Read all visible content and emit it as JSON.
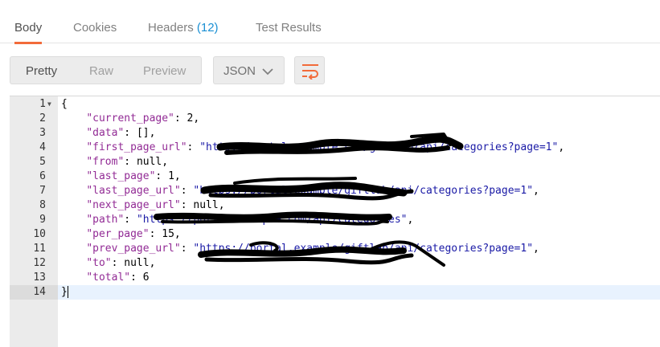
{
  "tabs": [
    {
      "label": "Body",
      "active": true
    },
    {
      "label": "Cookies",
      "active": false
    },
    {
      "label": "Headers",
      "count": "(12)",
      "active": false
    },
    {
      "label": "Test Results",
      "active": false
    }
  ],
  "view_modes": [
    "Pretty",
    "Raw",
    "Preview"
  ],
  "active_view_mode": "Pretty",
  "format": "JSON",
  "colors": {
    "accent": "#f26b3a",
    "count": "#1a8fd3",
    "json_key": "#922b95",
    "json_string": "#1a1aa6",
    "current_line": "#e8f2fe"
  },
  "icons": {
    "format_dropdown": "chevron-down-icon",
    "wrap": "wrap-lines-icon",
    "fold": "fold-arrow-icon"
  },
  "editor": {
    "lines": [
      {
        "num": "1",
        "open": "{"
      },
      {
        "num": "2",
        "key": "\"current_page\"",
        "sep": ": ",
        "val": "2",
        "tail": ","
      },
      {
        "num": "3",
        "key": "\"data\"",
        "sep": ": ",
        "val": "[]",
        "tail": ","
      },
      {
        "num": "4",
        "key": "\"first_page_url\"",
        "sep": ": ",
        "val": "\"http://portal.example.com/giftlab/api/categories?page=1\"",
        "tail": ","
      },
      {
        "num": "5",
        "key": "\"from\"",
        "sep": ": ",
        "val": "null",
        "tail": ","
      },
      {
        "num": "6",
        "key": "\"last_page\"",
        "sep": ": ",
        "val": "1",
        "tail": ","
      },
      {
        "num": "7",
        "key": "\"last_page_url\"",
        "sep": ": ",
        "val": "\"https://portal.example/giftlab/api/categories?page=1\"",
        "tail": ","
      },
      {
        "num": "8",
        "key": "\"next_page_url\"",
        "sep": ": ",
        "val": "null",
        "tail": ","
      },
      {
        "num": "9",
        "key": "\"path\"",
        "sep": ": ",
        "val": "\"https://portal.example.com/api/categories\"",
        "tail": ","
      },
      {
        "num": "10",
        "key": "\"per_page\"",
        "sep": ": ",
        "val": "15",
        "tail": ","
      },
      {
        "num": "11",
        "key": "\"prev_page_url\"",
        "sep": ": ",
        "val": "\"https://portal.example/giftlab/api/categories?page=1\"",
        "tail": ","
      },
      {
        "num": "12",
        "key": "\"to\"",
        "sep": ": ",
        "val": "null",
        "tail": ","
      },
      {
        "num": "13",
        "key": "\"total\"",
        "sep": ": ",
        "val": "6",
        "tail": ""
      },
      {
        "num": "14",
        "open": "}"
      }
    ]
  }
}
